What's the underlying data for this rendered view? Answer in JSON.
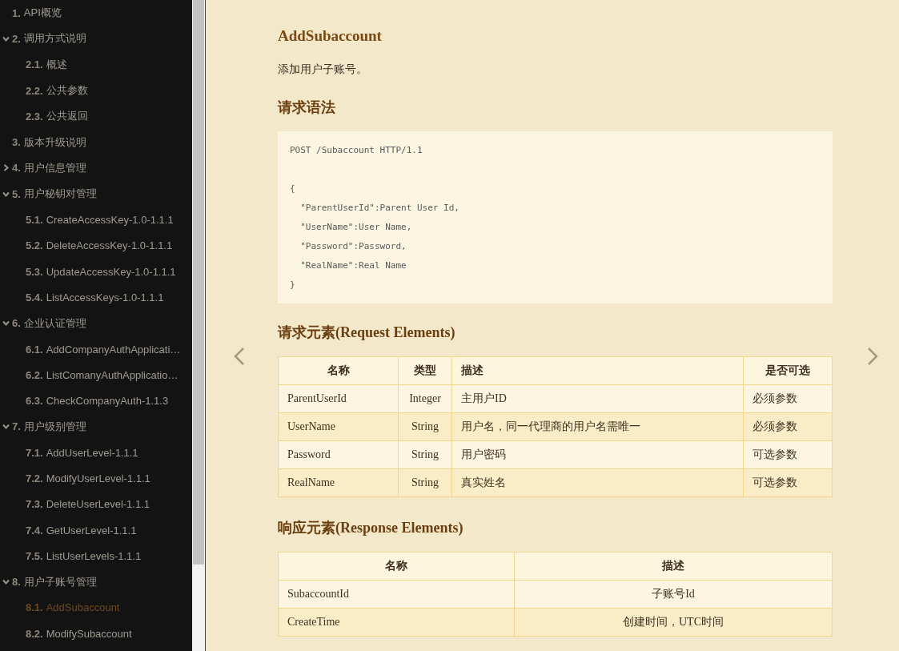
{
  "sidebar": {
    "items": [
      {
        "number": "1.",
        "label": "API概览",
        "kind": "leaf",
        "selected": false
      },
      {
        "number": "2.",
        "label": "调用方式说明",
        "kind": "group",
        "expanded": true,
        "selected": false,
        "children": [
          {
            "number": "2.1.",
            "label": "概述",
            "selected": false
          },
          {
            "number": "2.2.",
            "label": "公共参数",
            "selected": false
          },
          {
            "number": "2.3.",
            "label": "公共返回",
            "selected": false
          }
        ]
      },
      {
        "number": "3.",
        "label": "版本升级说明",
        "kind": "leaf",
        "selected": false
      },
      {
        "number": "4.",
        "label": "用户信息管理",
        "kind": "group",
        "expanded": false,
        "selected": false
      },
      {
        "number": "5.",
        "label": "用户秘钥对管理",
        "kind": "group",
        "expanded": true,
        "selected": false,
        "children": [
          {
            "number": "5.1.",
            "label": "CreateAccessKey-1.0-1.1.1",
            "selected": false
          },
          {
            "number": "5.2.",
            "label": "DeleteAccessKey-1.0-1.1.1",
            "selected": false
          },
          {
            "number": "5.3.",
            "label": "UpdateAccessKey-1.0-1.1.1",
            "selected": false
          },
          {
            "number": "5.4.",
            "label": "ListAccessKeys-1.0-1.1.1",
            "selected": false
          }
        ]
      },
      {
        "number": "6.",
        "label": "企业认证管理",
        "kind": "group",
        "expanded": true,
        "selected": false,
        "children": [
          {
            "number": "6.1.",
            "label": "AddCompanyAuthApplicati…",
            "selected": false
          },
          {
            "number": "6.2.",
            "label": "ListComanyAuthApplicatio…",
            "selected": false
          },
          {
            "number": "6.3.",
            "label": "CheckCompanyAuth-1.1.3",
            "selected": false
          }
        ]
      },
      {
        "number": "7.",
        "label": "用户级别管理",
        "kind": "group",
        "expanded": true,
        "selected": false,
        "children": [
          {
            "number": "7.1.",
            "label": "AddUserLevel-1.1.1",
            "selected": false
          },
          {
            "number": "7.2.",
            "label": "ModifyUserLevel-1.1.1",
            "selected": false
          },
          {
            "number": "7.3.",
            "label": "DeleteUserLevel-1.1.1",
            "selected": false
          },
          {
            "number": "7.4.",
            "label": "GetUserLevel-1.1.1",
            "selected": false
          },
          {
            "number": "7.5.",
            "label": "ListUserLevels-1.1.1",
            "selected": false
          }
        ]
      },
      {
        "number": "8.",
        "label": "用户子账号管理",
        "kind": "group",
        "expanded": true,
        "selected": false,
        "children": [
          {
            "number": "8.1.",
            "label": "AddSubaccount",
            "selected": true
          },
          {
            "number": "8.2.",
            "label": "ModifySubaccount",
            "selected": false
          }
        ]
      }
    ]
  },
  "content": {
    "title": "AddSubaccount",
    "description": "添加用户子账号。",
    "syntax_heading": "请求语法",
    "code_blocks": [
      [
        "POST /Subaccount HTTP/1.1"
      ],
      [
        "{",
        "  \"ParentUserId\":Parent User Id,",
        "  \"UserName\":User Name,",
        "  \"Password\":Password,",
        "  \"RealName\":Real Name",
        "}"
      ]
    ],
    "request_heading": "请求元素(Request Elements)",
    "request_table": {
      "columns": [
        "名称",
        "类型",
        "描述",
        "是否可选"
      ],
      "rows": [
        [
          "ParentUserId",
          "Integer",
          "主用户ID",
          "必须参数"
        ],
        [
          "UserName",
          "String",
          "用户名，同一代理商的用户名需唯一",
          "必须参数"
        ],
        [
          "Password",
          "String",
          "用户密码",
          "可选参数"
        ],
        [
          "RealName",
          "String",
          "真实姓名",
          "可选参数"
        ]
      ]
    },
    "response_heading": "响应元素(Response Elements)",
    "response_table": {
      "columns": [
        "名称",
        "描述"
      ],
      "rows": [
        [
          "SubaccountId",
          "子账号Id"
        ],
        [
          "CreateTime",
          "创建时间，UTC时间"
        ]
      ]
    }
  }
}
